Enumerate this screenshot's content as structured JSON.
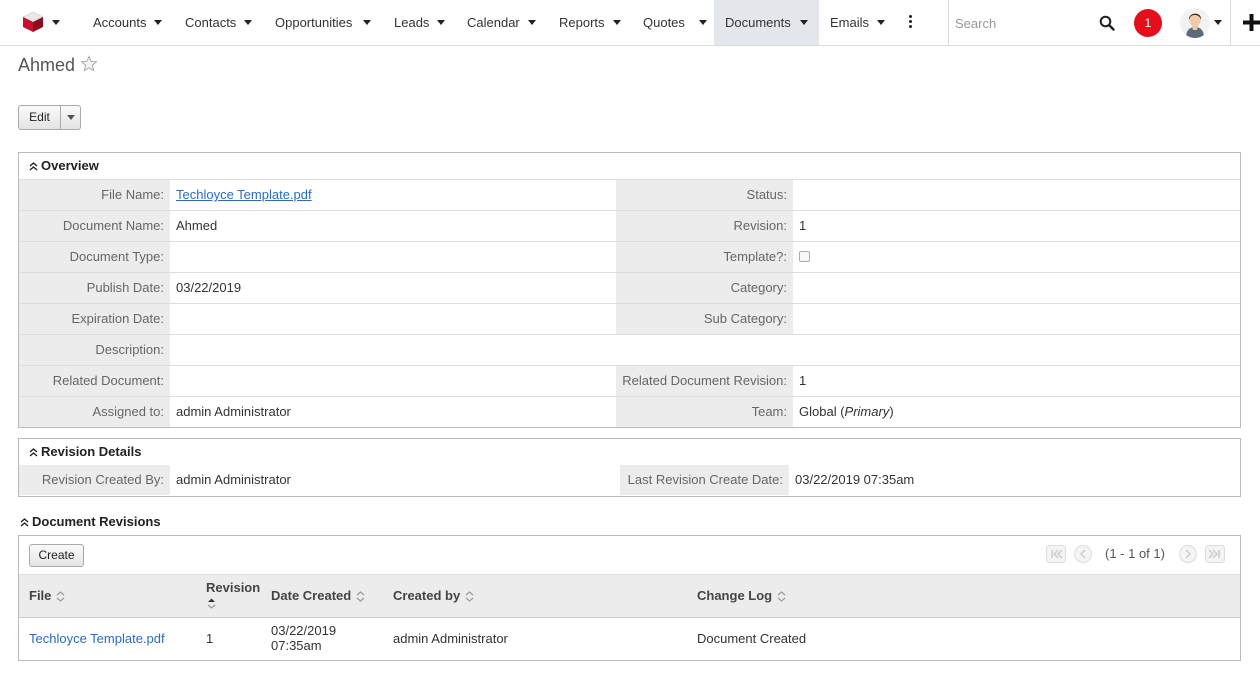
{
  "nav": {
    "items": [
      {
        "label": "Accounts"
      },
      {
        "label": "Contacts"
      },
      {
        "label": "Opportunities"
      },
      {
        "label": "Leads"
      },
      {
        "label": "Calendar"
      },
      {
        "label": "Reports"
      },
      {
        "label": "Quotes"
      },
      {
        "label": "Documents",
        "active": true
      },
      {
        "label": "Emails"
      }
    ],
    "search_placeholder": "Search",
    "notification_count": "1",
    "accent_color": "#e30f1c"
  },
  "record": {
    "title": "Ahmed",
    "edit_label": "Edit"
  },
  "overview": {
    "title": "Overview",
    "file_name_label": "File Name:",
    "file_name_value": "Techloyce Template.pdf",
    "status_label": "Status:",
    "status_value": "",
    "document_name_label": "Document Name:",
    "document_name_value": "Ahmed",
    "revision_label": "Revision:",
    "revision_value": "1",
    "document_type_label": "Document Type:",
    "document_type_value": "",
    "template_label": "Template?:",
    "template_checked": false,
    "publish_date_label": "Publish Date:",
    "publish_date_value": "03/22/2019",
    "category_label": "Category:",
    "category_value": "",
    "expiration_date_label": "Expiration Date:",
    "expiration_date_value": "",
    "sub_category_label": "Sub Category:",
    "sub_category_value": "",
    "description_label": "Description:",
    "description_value": "",
    "related_document_label": "Related Document:",
    "related_document_value": "",
    "related_document_revision_label": "Related Document Revision:",
    "related_document_revision_value": "1",
    "assigned_to_label": "Assigned to:",
    "assigned_to_value": "admin Administrator",
    "team_label": "Team:",
    "team_value": "Global",
    "team_primary": "Primary"
  },
  "revision_details": {
    "title": "Revision Details",
    "created_by_label": "Revision Created By:",
    "created_by_value": "admin Administrator",
    "last_create_date_label": "Last Revision Create Date:",
    "last_create_date_value": "03/22/2019 07:35am"
  },
  "revisions": {
    "title": "Document Revisions",
    "create_label": "Create",
    "pagination": "(1 - 1 of 1)",
    "columns": {
      "file": "File",
      "revision": "Revision",
      "date_created": "Date Created",
      "created_by": "Created by",
      "change_log": "Change Log"
    },
    "rows": [
      {
        "file": "Techloyce Template.pdf",
        "revision": "1",
        "date_line1": "03/22/2019",
        "date_line2": "07:35am",
        "created_by": "admin Administrator",
        "change_log": "Document Created"
      }
    ]
  }
}
